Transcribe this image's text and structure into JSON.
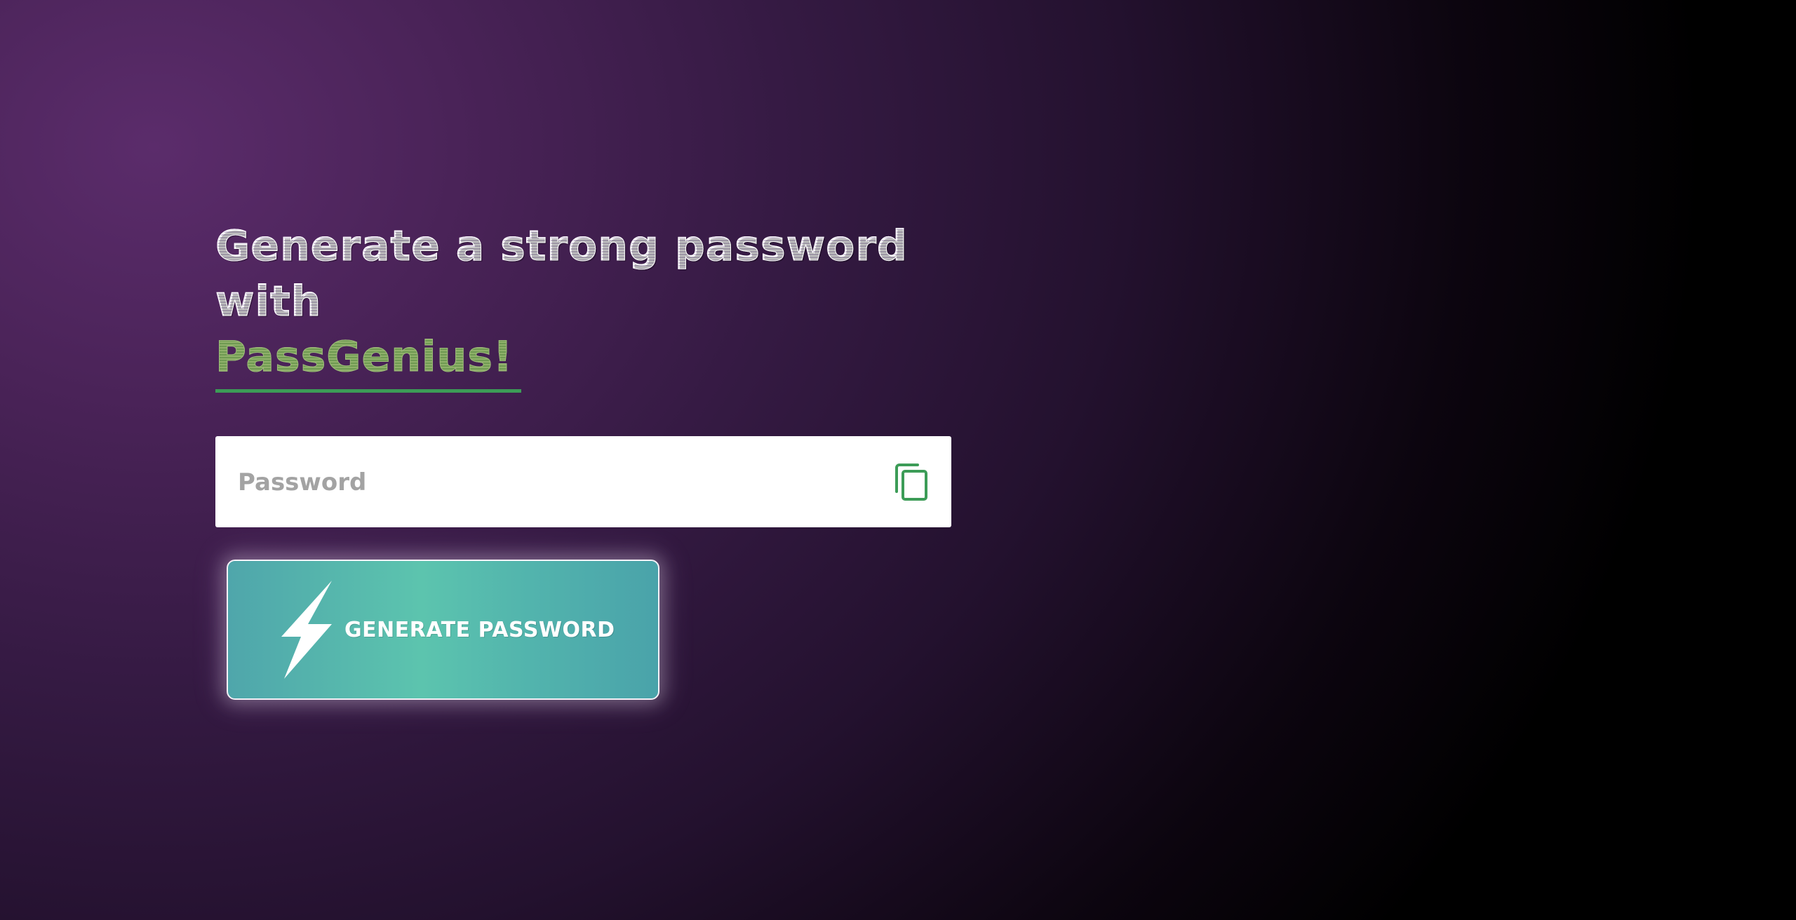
{
  "hero": {
    "headline": "Generate a strong password with",
    "brand": "PassGenius!"
  },
  "password": {
    "placeholder": "Password",
    "value": ""
  },
  "icons": {
    "copy": "copy-icon",
    "generate": "lightning-bolt-icon"
  },
  "generate_button": {
    "label": "GENERATE PASSWORD"
  },
  "colors": {
    "accent_green": "#3c9c57",
    "brand_text": "#8fb06a",
    "button_gradient_start": "#4fa6ab",
    "button_gradient_mid": "#5cc4ae",
    "background_purple": "#5b2c6b"
  }
}
